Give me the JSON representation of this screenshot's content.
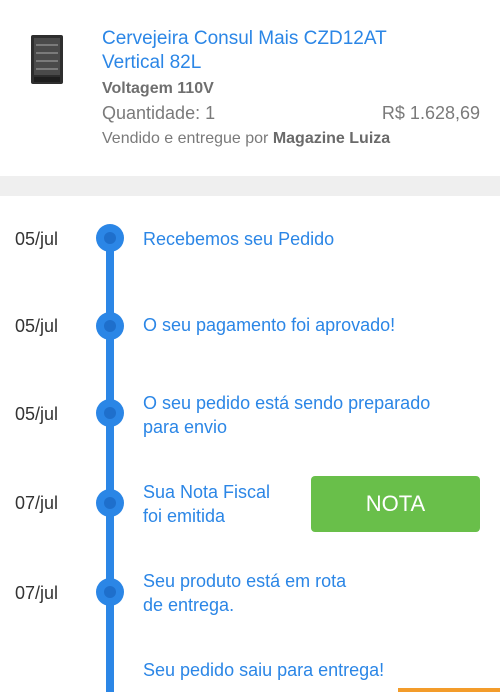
{
  "product": {
    "name_line1": "Cervejeira Consul Mais CZD12AT",
    "name_line2": "Vertical 82L",
    "voltage": "Voltagem 110V",
    "quantity": "Quantidade: 1",
    "price": "R$ 1.628,69",
    "seller_prefix": "Vendido e entregue por",
    "seller_name": "Magazine Luiza",
    "image_icon": "fridge-icon"
  },
  "timeline": {
    "events": [
      {
        "date": "05/jul",
        "line1": "Recebemos seu Pedido",
        "line2": ""
      },
      {
        "date": "05/jul",
        "line1": "O seu pagamento foi aprovado!",
        "line2": ""
      },
      {
        "date": "05/jul",
        "line1": "O seu pedido está sendo preparado",
        "line2": "para envio"
      },
      {
        "date": "07/jul",
        "line1": "Sua Nota Fiscal",
        "line2": "foi emitida"
      },
      {
        "date": "07/jul",
        "line1": "Seu produto está em rota",
        "line2": "de entrega."
      },
      {
        "date": "",
        "line1": "Seu pedido saiu para entrega!",
        "line2": ""
      }
    ],
    "nota_button": "NOTA"
  },
  "colors": {
    "accent": "#2b86e6",
    "button": "#69bf4a",
    "divider": "#efefef",
    "bottom_bar": "#f39c2a"
  }
}
